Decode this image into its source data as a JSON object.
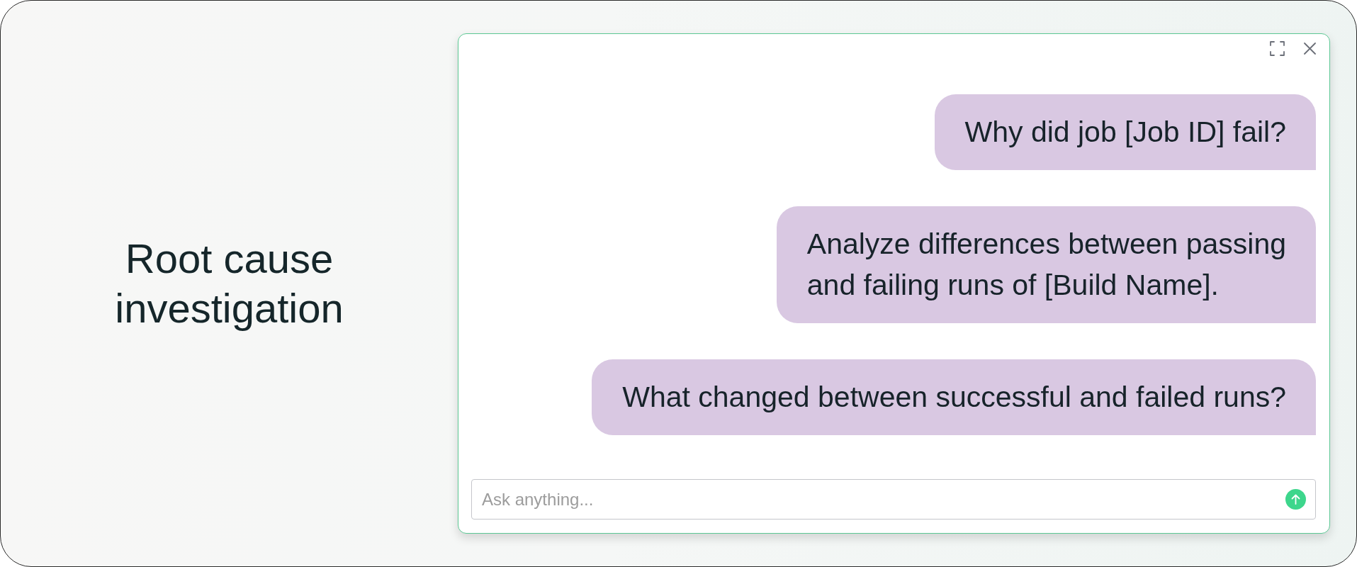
{
  "hero": {
    "title": "Root cause investigation"
  },
  "chat": {
    "messages": [
      {
        "text": "Why did job [Job ID] fail?"
      },
      {
        "text": "Analyze differences between passing\nand failing runs of [Build Name]."
      },
      {
        "text": "What changed between successful and failed runs?"
      }
    ],
    "input": {
      "placeholder": "Ask anything..."
    }
  }
}
